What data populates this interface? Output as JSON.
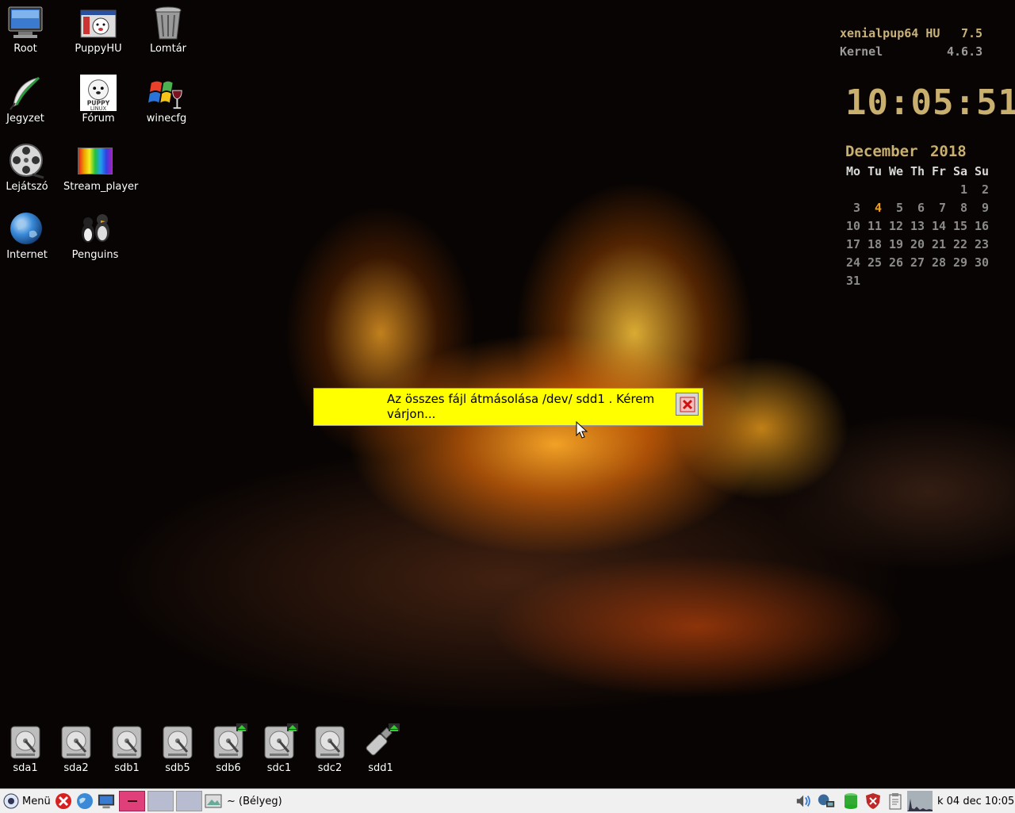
{
  "desktop": {
    "icons": [
      {
        "label": "Root",
        "icon": "monitor-icon"
      },
      {
        "label": "PuppyHU",
        "icon": "puppy-browser-icon"
      },
      {
        "label": "Lomtár",
        "icon": "trash-icon"
      },
      {
        "label": "Jegyzet",
        "icon": "quill-icon"
      },
      {
        "label": "Fórum",
        "icon": "puppy-forum-icon"
      },
      {
        "label": "winecfg",
        "icon": "wine-icon"
      },
      {
        "label": "Lejátszó",
        "icon": "film-reel-icon"
      },
      {
        "label": "Stream_player",
        "icon": "rainbow-icon"
      },
      {
        "label": "Internet",
        "icon": "globe-icon"
      },
      {
        "label": "Penguins",
        "icon": "penguins-icon"
      }
    ],
    "drives": [
      {
        "label": "sda1",
        "mounted": false
      },
      {
        "label": "sda2",
        "mounted": false
      },
      {
        "label": "sdb1",
        "mounted": false
      },
      {
        "label": "sdb5",
        "mounted": false
      },
      {
        "label": "sdb6",
        "mounted": true
      },
      {
        "label": "sdc1",
        "mounted": true
      },
      {
        "label": "sdc2",
        "mounted": false
      },
      {
        "label": "sdd1",
        "mounted": true,
        "usb": true
      }
    ]
  },
  "conky": {
    "host": "xenialpup64 HU",
    "version": "7.5",
    "kernel_label": "Kernel",
    "kernel": "4.6.3",
    "clock": "10:05:51",
    "month": "December",
    "year": "2018",
    "weekdays": [
      "Mo",
      "Tu",
      "We",
      "Th",
      "Fr",
      "Sa",
      "Su"
    ],
    "weeks": [
      [
        "",
        "",
        "",
        "",
        "",
        "1",
        "2"
      ],
      [
        "3",
        "4",
        "5",
        "6",
        "7",
        "8",
        "9"
      ],
      [
        "10",
        "11",
        "12",
        "13",
        "14",
        "15",
        "16"
      ],
      [
        "17",
        "18",
        "19",
        "20",
        "21",
        "22",
        "23"
      ],
      [
        "24",
        "25",
        "26",
        "27",
        "28",
        "29",
        "30"
      ],
      [
        "31",
        "",
        "",
        "",
        "",
        "",
        ""
      ]
    ],
    "today": "4",
    "colors": {
      "text": "#c9b06e",
      "today": "#f0a020",
      "days": "#8a8a8a"
    }
  },
  "dialog": {
    "message": "Az összes fájl átmásolása /dev/ sdd1 . Kérem várjon...",
    "background": "#ffff00"
  },
  "taskbar": {
    "menu_label": "Menü",
    "window_title": "~ (Bélyeg)",
    "clock": "k 04 dec 10:05",
    "pager_active_color": "#e0407a"
  }
}
